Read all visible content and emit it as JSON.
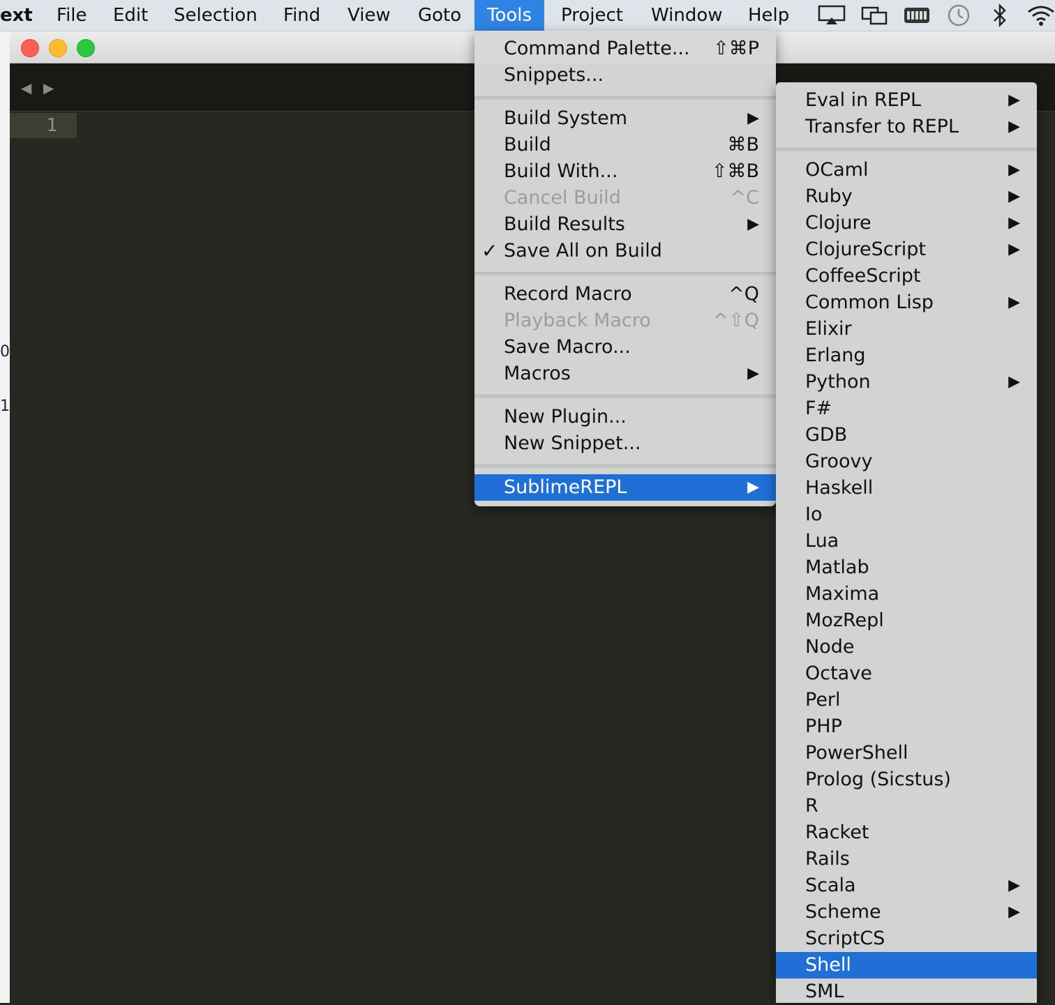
{
  "menubar": {
    "app": "ext",
    "items": [
      "File",
      "Edit",
      "Selection",
      "Find",
      "View",
      "Goto",
      "Tools",
      "Project",
      "Window",
      "Help"
    ],
    "active": "Tools"
  },
  "editor": {
    "line_number": "1"
  },
  "left_window": {
    "marks": [
      "0",
      "1"
    ]
  },
  "tools_menu": {
    "groups": [
      [
        {
          "label": "Command Palette...",
          "shortcut": "⇧⌘P"
        },
        {
          "label": "Snippets...",
          "shortcut": ""
        }
      ],
      [
        {
          "label": "Build System",
          "shortcut": "",
          "submenu": true
        },
        {
          "label": "Build",
          "shortcut": "⌘B"
        },
        {
          "label": "Build With...",
          "shortcut": "⇧⌘B"
        },
        {
          "label": "Cancel Build",
          "shortcut": "^C",
          "disabled": true
        },
        {
          "label": "Build Results",
          "shortcut": "",
          "submenu": true
        },
        {
          "label": "Save All on Build",
          "shortcut": "",
          "checked": true
        }
      ],
      [
        {
          "label": "Record Macro",
          "shortcut": "^Q"
        },
        {
          "label": "Playback Macro",
          "shortcut": "^⇧Q",
          "disabled": true
        },
        {
          "label": "Save Macro...",
          "shortcut": ""
        },
        {
          "label": "Macros",
          "shortcut": "",
          "submenu": true
        }
      ],
      [
        {
          "label": "New Plugin...",
          "shortcut": ""
        },
        {
          "label": "New Snippet...",
          "shortcut": ""
        }
      ],
      [
        {
          "label": "SublimeREPL",
          "shortcut": "",
          "submenu": true,
          "highlighted": true
        }
      ]
    ]
  },
  "repl_menu": {
    "top_items": [
      {
        "label": "Eval in REPL",
        "submenu": true
      },
      {
        "label": "Transfer to REPL",
        "submenu": true
      }
    ],
    "languages": [
      {
        "label": "OCaml",
        "submenu": true
      },
      {
        "label": "Ruby",
        "submenu": true
      },
      {
        "label": "Clojure",
        "submenu": true
      },
      {
        "label": "ClojureScript",
        "submenu": true
      },
      {
        "label": "CoffeeScript"
      },
      {
        "label": "Common Lisp",
        "submenu": true
      },
      {
        "label": "Elixir"
      },
      {
        "label": "Erlang"
      },
      {
        "label": "Python",
        "submenu": true
      },
      {
        "label": "F#"
      },
      {
        "label": "GDB"
      },
      {
        "label": "Groovy"
      },
      {
        "label": "Haskell"
      },
      {
        "label": "Io"
      },
      {
        "label": "Lua"
      },
      {
        "label": "Matlab"
      },
      {
        "label": "Maxima"
      },
      {
        "label": "MozRepl"
      },
      {
        "label": "Node"
      },
      {
        "label": "Octave"
      },
      {
        "label": "Perl"
      },
      {
        "label": "PHP"
      },
      {
        "label": "PowerShell"
      },
      {
        "label": "Prolog (Sicstus)"
      },
      {
        "label": "R"
      },
      {
        "label": "Racket"
      },
      {
        "label": "Rails"
      },
      {
        "label": "Scala",
        "submenu": true
      },
      {
        "label": "Scheme",
        "submenu": true
      },
      {
        "label": "ScriptCS"
      },
      {
        "label": "Shell",
        "highlighted": true
      },
      {
        "label": "SML"
      }
    ]
  },
  "icons": {
    "nav_back": "◀",
    "nav_forward": "▶",
    "submenu_arrow": "▶",
    "check": "✓"
  },
  "colors": {
    "editor_bg": "#272822",
    "menu_bg": "#d6d8d8",
    "highlight": "#1f6fd6",
    "menubar_active": "#2f84e3"
  }
}
